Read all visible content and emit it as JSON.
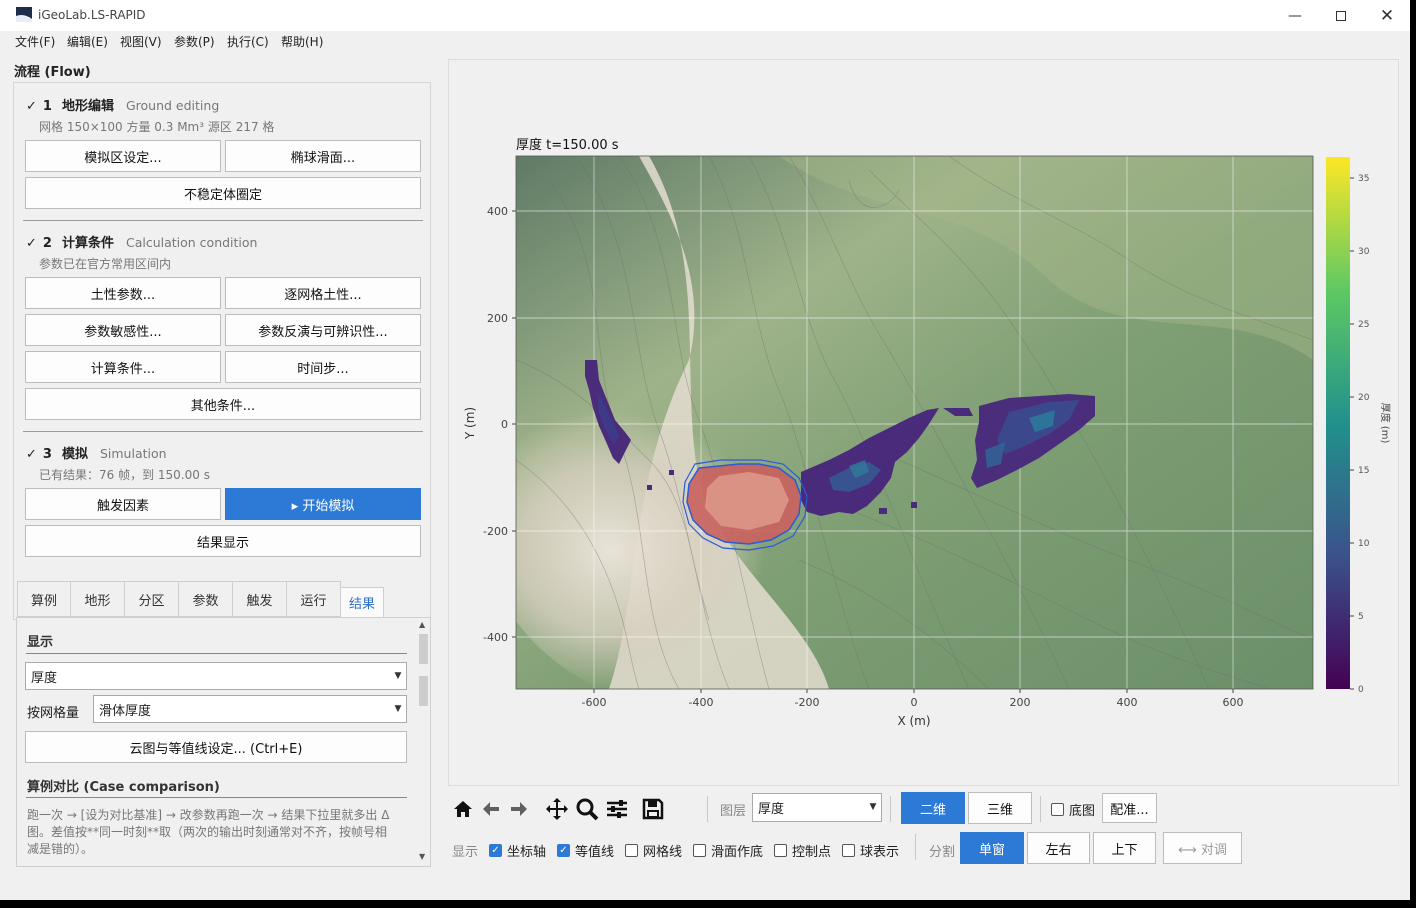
{
  "window": {
    "title": "iGeoLab.LS-RAPID"
  },
  "menu": [
    "文件(F)",
    "编辑(E)",
    "视图(V)",
    "参数(P)",
    "执行(C)",
    "帮助(H)"
  ],
  "flow": {
    "title": "流程 (Flow)",
    "step1": {
      "check": "✓",
      "num": "1",
      "zh": "地形编辑",
      "en": "Ground editing",
      "sub": "网格 150×100   方量 0.3 Mm³   源区 217 格",
      "buttons": [
        "模拟区设定...",
        "椭球滑面...",
        "不稳定体圈定"
      ]
    },
    "step2": {
      "check": "✓",
      "num": "2",
      "zh": "计算条件",
      "en": "Calculation condition",
      "sub": "参数已在官方常用区间内",
      "buttons": [
        "土性参数...",
        "逐网格土性...",
        "参数敏感性...",
        "参数反演与可辨识性...",
        "计算条件...",
        "时间步...",
        "其他条件..."
      ]
    },
    "step3": {
      "check": "✓",
      "num": "3",
      "zh": "模拟",
      "en": "Simulation",
      "sub": "已有结果：76 帧，到 150.00 s",
      "buttons": [
        "触发因素",
        "▸ 开始模拟",
        "结果显示"
      ]
    }
  },
  "tabs": [
    "算例",
    "地形",
    "分区",
    "参数",
    "触发",
    "运行",
    "结果"
  ],
  "active_tab": "结果",
  "result_panel": {
    "display_title": "显示",
    "display_value": "厚度",
    "grid_label": "按网格量",
    "grid_value": "滑体厚度",
    "contour_button": "云图与等值线设定...   (Ctrl+E)",
    "case_title": "算例对比 (Case comparison)",
    "case_desc": "跑一次 → [设为对比基准] → 改参数再跑一次 → 结果下拉里就多出 Δ 图。差值按**同一时刻**取（两次的输出时刻通常对不齐，按帧号相减是错的）。"
  },
  "plot": {
    "title": "厚度  t=150.00 s",
    "xlabel": "X (m)",
    "ylabel": "Y (m)",
    "cbar_label": "厚度 (m)",
    "xticks": [
      "-600",
      "-400",
      "-200",
      "0",
      "200",
      "400",
      "600"
    ],
    "yticks": [
      "400",
      "200",
      "0",
      "-200",
      "-400"
    ],
    "cticks": [
      "35",
      "30",
      "25",
      "20",
      "15",
      "10",
      "5",
      "0"
    ]
  },
  "toolbar": {
    "layer_label": "图层",
    "layer_value": "厚度",
    "btn_2d": "二维",
    "btn_3d": "三维",
    "basemap_label": "底图",
    "register_button": "配准...",
    "display_label": "显示",
    "checks": [
      {
        "label": "坐标轴",
        "on": true
      },
      {
        "label": "等值线",
        "on": true
      },
      {
        "label": "网格线",
        "on": false
      },
      {
        "label": "滑面作底",
        "on": false
      },
      {
        "label": "控制点",
        "on": false
      },
      {
        "label": "球表示",
        "on": false
      }
    ],
    "split_label": "分割",
    "split_single": "单窗",
    "split_lr": "左右",
    "split_ud": "上下",
    "sync_button": "⟷ 对调"
  },
  "colors": {
    "accent": "#2d7ad6"
  }
}
